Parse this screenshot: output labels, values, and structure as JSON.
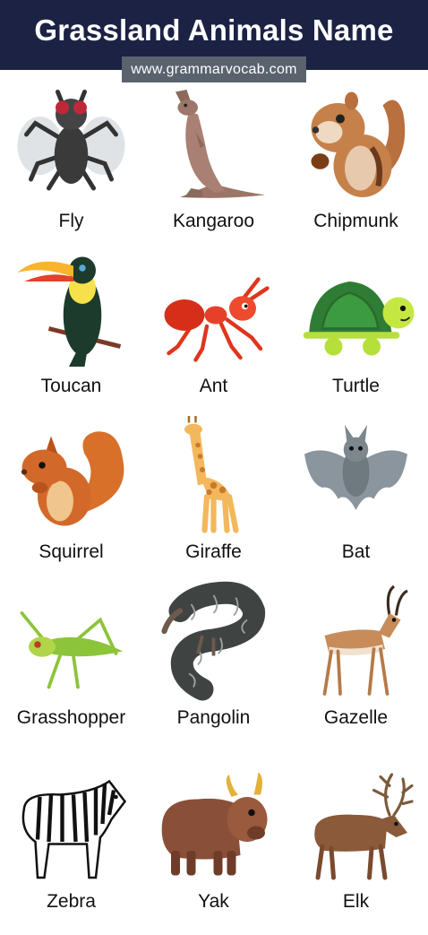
{
  "title": "Grassland Animals Name",
  "website": "www.grammarvocab.com",
  "animals": [
    {
      "name": "Fly",
      "icon": "fly-icon"
    },
    {
      "name": "Kangaroo",
      "icon": "kangaroo-icon"
    },
    {
      "name": "Chipmunk",
      "icon": "chipmunk-icon"
    },
    {
      "name": "Toucan",
      "icon": "toucan-icon"
    },
    {
      "name": "Ant",
      "icon": "ant-icon"
    },
    {
      "name": "Turtle",
      "icon": "turtle-icon"
    },
    {
      "name": "Squirrel",
      "icon": "squirrel-icon"
    },
    {
      "name": "Giraffe",
      "icon": "giraffe-icon"
    },
    {
      "name": "Bat",
      "icon": "bat-icon"
    },
    {
      "name": "Grasshopper",
      "icon": "grasshopper-icon"
    },
    {
      "name": "Pangolin",
      "icon": "pangolin-icon"
    },
    {
      "name": "Gazelle",
      "icon": "gazelle-icon"
    },
    {
      "name": "Zebra",
      "icon": "zebra-icon"
    },
    {
      "name": "Yak",
      "icon": "yak-icon"
    },
    {
      "name": "Elk",
      "icon": "elk-icon"
    }
  ],
  "colors": {
    "header_bg": "#1b2244",
    "site_bg": "#5a626e"
  }
}
